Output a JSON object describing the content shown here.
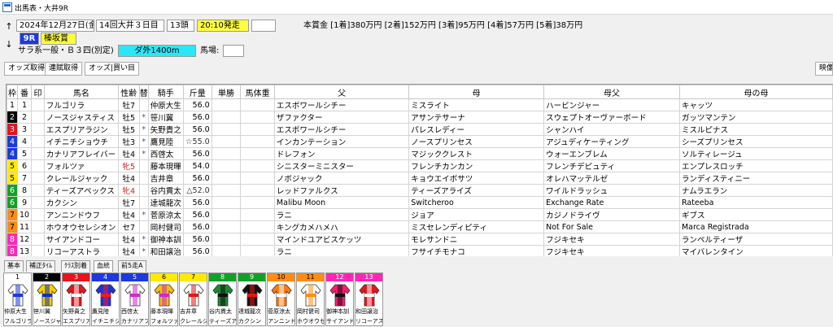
{
  "window": {
    "title": "出馬表・大井9R"
  },
  "race": {
    "date": "2024年12月27日(金)",
    "meeting": "14回大井３日目",
    "heads": "13頭",
    "start_time": "20:10発走",
    "race_no": "9R",
    "race_name": "榛坂賞",
    "condition": "サラ系一般・Ｂ３四(別定)",
    "course": "ダ外1400m",
    "track_label": "馬場:",
    "track_value": "",
    "prize": "本賞金 [1着]380万円 [2着]152万円 [3着]95万円 [4着]57万円 [5着]38万円"
  },
  "toolbar": {
    "odds": "オッズ取得",
    "renpuku": "連賦取得",
    "odds_buy": "オッズ|買い目",
    "video": "映像"
  },
  "table": {
    "headers": [
      "枠",
      "番",
      "印",
      "馬名",
      "性齢",
      "替",
      "騎手",
      "斤量",
      "単勝",
      "馬体重",
      "父",
      "母",
      "母父",
      "母の母"
    ],
    "rows": [
      {
        "waku": "1",
        "ban": "1",
        "name": "フルゴリラ",
        "sex": "牡7",
        "kae": "",
        "jockey": "仲原大生",
        "kin": "56.0",
        "sire": "エスポワールシチー",
        "dam": "ミスライト",
        "bms": "ハービンジャー",
        "damdam": "キャッツ"
      },
      {
        "waku": "2",
        "ban": "2",
        "name": "ノースジャスティス",
        "sex": "牡5",
        "kae": "*",
        "jockey": "笹川翼",
        "kin": "56.0",
        "sire": "ザファクター",
        "dam": "アサンテサーナ",
        "bms": "スウェプトオーヴァーボード",
        "damdam": "ガッツマンテン"
      },
      {
        "waku": "3",
        "ban": "3",
        "name": "エスプリアラジン",
        "sex": "牡5",
        "kae": "*",
        "jockey": "矢野貴之",
        "kin": "56.0",
        "sire": "エスポワールシチー",
        "dam": "パレスレディー",
        "bms": "シャンハイ",
        "damdam": "ミスルピナス"
      },
      {
        "waku": "4",
        "ban": "4",
        "name": "イチニチショウチ",
        "sex": "牡3",
        "kae": "*",
        "jockey": "鷹見陸",
        "kin": "☆55.0",
        "sire": "インカンテーション",
        "dam": "ノースプリンセス",
        "bms": "アジュディケーティング",
        "damdam": "シーズプリンセス"
      },
      {
        "waku": "4",
        "ban": "5",
        "name": "カナリアフレイバー",
        "sex": "牡4",
        "kae": "*",
        "jockey": "西啓太",
        "kin": "56.0",
        "sire": "ドレフォン",
        "dam": "マジッククレスト",
        "bms": "ウォーエンブレム",
        "damdam": "ソルティレージュ"
      },
      {
        "waku": "5",
        "ban": "6",
        "name": "フォルツァ",
        "sex": "牝5",
        "kae": "",
        "jockey": "藤本現暉",
        "kin": "54.0",
        "sire": "シニスターミニスター",
        "dam": "フレンチカンカン",
        "bms": "フレンチデピュティ",
        "damdam": "エンプレスロッチ"
      },
      {
        "waku": "5",
        "ban": "7",
        "name": "クレールジャック",
        "sex": "牡4",
        "kae": "",
        "jockey": "吉井章",
        "kin": "56.0",
        "sire": "ノボジャック",
        "dam": "キョウエイボサツ",
        "bms": "オレハマッテルゼ",
        "damdam": "ランディスティニー"
      },
      {
        "waku": "6",
        "ban": "8",
        "name": "ティーズアペックス",
        "sex": "牝4",
        "kae": "",
        "jockey": "谷内貫太",
        "kin": "△52.0",
        "sire": "レッドファルクス",
        "dam": "ティーズアライズ",
        "bms": "ワイルドラッシュ",
        "damdam": "ナムラエラン"
      },
      {
        "waku": "6",
        "ban": "9",
        "name": "カクシン",
        "sex": "牡7",
        "kae": "",
        "jockey": "達城龍次",
        "kin": "56.0",
        "sire": "Malibu Moon",
        "dam": "Switcheroo",
        "bms": "Exchange Rate",
        "damdam": "Rateeba"
      },
      {
        "waku": "7",
        "ban": "10",
        "name": "アンニンドウフ",
        "sex": "牡4",
        "kae": "*",
        "jockey": "菅原涼太",
        "kin": "56.0",
        "sire": "ラニ",
        "dam": "ジョア",
        "bms": "カジノドライヴ",
        "damdam": "ギブス"
      },
      {
        "waku": "7",
        "ban": "11",
        "name": "ホウオウセレシオン",
        "sex": "セ7",
        "kae": "",
        "jockey": "岡村健司",
        "kin": "56.0",
        "sire": "キングカメハメハ",
        "dam": "ミスセレンディピティ",
        "bms": "Not For Sale",
        "damdam": "Marca Registrada"
      },
      {
        "waku": "8",
        "ban": "12",
        "name": "サイアンドコー",
        "sex": "牡4",
        "kae": "*",
        "jockey": "御神本訓",
        "kin": "56.0",
        "sire": "マインドユアビスケッツ",
        "dam": "モレサンドニ",
        "bms": "フジキセキ",
        "damdam": "ランペルティーザ"
      },
      {
        "waku": "8",
        "ban": "13",
        "name": "リコーアストラ",
        "sex": "牡4",
        "kae": "*",
        "jockey": "和田譲治",
        "kin": "56.0",
        "sire": "ラニ",
        "dam": "フサイチモナコ",
        "bms": "フジキセキ",
        "damdam": "マイバレンタイン"
      }
    ]
  },
  "tabs": [
    "基本",
    "補正ﾀｲﾑ",
    "ｸﾗｽ別着",
    "血統",
    "前5走A"
  ],
  "silks": [
    {
      "num": "1",
      "jockey": "仲原大生",
      "horse": "フルゴリラ"
    },
    {
      "num": "2",
      "jockey": "笹川翼",
      "horse": "ノースジャ"
    },
    {
      "num": "3",
      "jockey": "矢野貴之",
      "horse": "エスプリア"
    },
    {
      "num": "4",
      "jockey": "鷹見陸",
      "horse": "イチニチシ"
    },
    {
      "num": "5",
      "jockey": "西啓太",
      "horse": "カナリアフ"
    },
    {
      "num": "6",
      "jockey": "藤本現暉",
      "horse": "フォルツァ"
    },
    {
      "num": "7",
      "jockey": "吉井章",
      "horse": "クレールジ"
    },
    {
      "num": "8",
      "jockey": "谷内貫太",
      "horse": "ティーズア"
    },
    {
      "num": "9",
      "jockey": "達城龍次",
      "horse": "カクシン"
    },
    {
      "num": "10",
      "jockey": "菅原涼太",
      "horse": "アンニンド"
    },
    {
      "num": "11",
      "jockey": "岡村健司",
      "horse": "ホウオウセ"
    },
    {
      "num": "12",
      "jockey": "御神本訓",
      "horse": "サイアンド"
    },
    {
      "num": "13",
      "jockey": "和田譲治",
      "horse": "リコーアス"
    }
  ],
  "colors": {
    "waku": {
      "1": [
        "#ffffff",
        "#000000"
      ],
      "2": [
        "#000000",
        "#ffffff"
      ],
      "3": [
        "#e8141c",
        "#ffffff"
      ],
      "4": [
        "#1c3ae0",
        "#ffffff"
      ],
      "5": [
        "#ffea00",
        "#000000"
      ],
      "6": [
        "#14a028",
        "#ffffff"
      ],
      "7": [
        "#ff8c14",
        "#000000"
      ],
      "8": [
        "#ff28b4",
        "#ffffff"
      ]
    },
    "race_no_bg": "#1c3ae0",
    "race_name_bg": "#ffff40",
    "start_time_bg": "#ffff40",
    "course_bg": "#28e8f8"
  }
}
